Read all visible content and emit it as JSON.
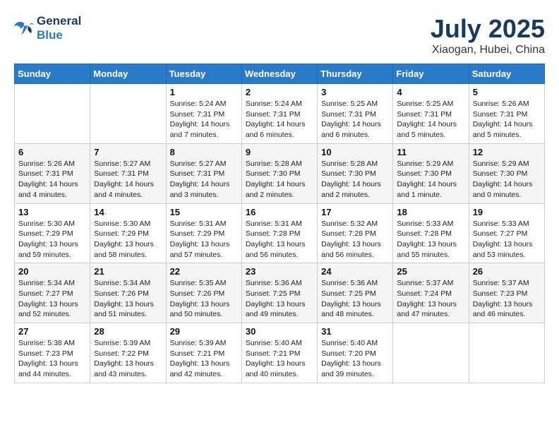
{
  "header": {
    "logo_line1": "General",
    "logo_line2": "Blue",
    "title": "July 2025",
    "subtitle": "Xiaogan, Hubei, China"
  },
  "weekdays": [
    "Sunday",
    "Monday",
    "Tuesday",
    "Wednesday",
    "Thursday",
    "Friday",
    "Saturday"
  ],
  "weeks": [
    [
      {
        "day": "",
        "info": ""
      },
      {
        "day": "",
        "info": ""
      },
      {
        "day": "1",
        "info": "Sunrise: 5:24 AM\nSunset: 7:31 PM\nDaylight: 14 hours and 7 minutes."
      },
      {
        "day": "2",
        "info": "Sunrise: 5:24 AM\nSunset: 7:31 PM\nDaylight: 14 hours and 6 minutes."
      },
      {
        "day": "3",
        "info": "Sunrise: 5:25 AM\nSunset: 7:31 PM\nDaylight: 14 hours and 6 minutes."
      },
      {
        "day": "4",
        "info": "Sunrise: 5:25 AM\nSunset: 7:31 PM\nDaylight: 14 hours and 5 minutes."
      },
      {
        "day": "5",
        "info": "Sunrise: 5:26 AM\nSunset: 7:31 PM\nDaylight: 14 hours and 5 minutes."
      }
    ],
    [
      {
        "day": "6",
        "info": "Sunrise: 5:26 AM\nSunset: 7:31 PM\nDaylight: 14 hours and 4 minutes."
      },
      {
        "day": "7",
        "info": "Sunrise: 5:27 AM\nSunset: 7:31 PM\nDaylight: 14 hours and 4 minutes."
      },
      {
        "day": "8",
        "info": "Sunrise: 5:27 AM\nSunset: 7:31 PM\nDaylight: 14 hours and 3 minutes."
      },
      {
        "day": "9",
        "info": "Sunrise: 5:28 AM\nSunset: 7:30 PM\nDaylight: 14 hours and 2 minutes."
      },
      {
        "day": "10",
        "info": "Sunrise: 5:28 AM\nSunset: 7:30 PM\nDaylight: 14 hours and 2 minutes."
      },
      {
        "day": "11",
        "info": "Sunrise: 5:29 AM\nSunset: 7:30 PM\nDaylight: 14 hours and 1 minute."
      },
      {
        "day": "12",
        "info": "Sunrise: 5:29 AM\nSunset: 7:30 PM\nDaylight: 14 hours and 0 minutes."
      }
    ],
    [
      {
        "day": "13",
        "info": "Sunrise: 5:30 AM\nSunset: 7:29 PM\nDaylight: 13 hours and 59 minutes."
      },
      {
        "day": "14",
        "info": "Sunrise: 5:30 AM\nSunset: 7:29 PM\nDaylight: 13 hours and 58 minutes."
      },
      {
        "day": "15",
        "info": "Sunrise: 5:31 AM\nSunset: 7:29 PM\nDaylight: 13 hours and 57 minutes."
      },
      {
        "day": "16",
        "info": "Sunrise: 5:31 AM\nSunset: 7:28 PM\nDaylight: 13 hours and 56 minutes."
      },
      {
        "day": "17",
        "info": "Sunrise: 5:32 AM\nSunset: 7:28 PM\nDaylight: 13 hours and 56 minutes."
      },
      {
        "day": "18",
        "info": "Sunrise: 5:33 AM\nSunset: 7:28 PM\nDaylight: 13 hours and 55 minutes."
      },
      {
        "day": "19",
        "info": "Sunrise: 5:33 AM\nSunset: 7:27 PM\nDaylight: 13 hours and 53 minutes."
      }
    ],
    [
      {
        "day": "20",
        "info": "Sunrise: 5:34 AM\nSunset: 7:27 PM\nDaylight: 13 hours and 52 minutes."
      },
      {
        "day": "21",
        "info": "Sunrise: 5:34 AM\nSunset: 7:26 PM\nDaylight: 13 hours and 51 minutes."
      },
      {
        "day": "22",
        "info": "Sunrise: 5:35 AM\nSunset: 7:26 PM\nDaylight: 13 hours and 50 minutes."
      },
      {
        "day": "23",
        "info": "Sunrise: 5:36 AM\nSunset: 7:25 PM\nDaylight: 13 hours and 49 minutes."
      },
      {
        "day": "24",
        "info": "Sunrise: 5:36 AM\nSunset: 7:25 PM\nDaylight: 13 hours and 48 minutes."
      },
      {
        "day": "25",
        "info": "Sunrise: 5:37 AM\nSunset: 7:24 PM\nDaylight: 13 hours and 47 minutes."
      },
      {
        "day": "26",
        "info": "Sunrise: 5:37 AM\nSunset: 7:23 PM\nDaylight: 13 hours and 46 minutes."
      }
    ],
    [
      {
        "day": "27",
        "info": "Sunrise: 5:38 AM\nSunset: 7:23 PM\nDaylight: 13 hours and 44 minutes."
      },
      {
        "day": "28",
        "info": "Sunrise: 5:39 AM\nSunset: 7:22 PM\nDaylight: 13 hours and 43 minutes."
      },
      {
        "day": "29",
        "info": "Sunrise: 5:39 AM\nSunset: 7:21 PM\nDaylight: 13 hours and 42 minutes."
      },
      {
        "day": "30",
        "info": "Sunrise: 5:40 AM\nSunset: 7:21 PM\nDaylight: 13 hours and 40 minutes."
      },
      {
        "day": "31",
        "info": "Sunrise: 5:40 AM\nSunset: 7:20 PM\nDaylight: 13 hours and 39 minutes."
      },
      {
        "day": "",
        "info": ""
      },
      {
        "day": "",
        "info": ""
      }
    ]
  ]
}
